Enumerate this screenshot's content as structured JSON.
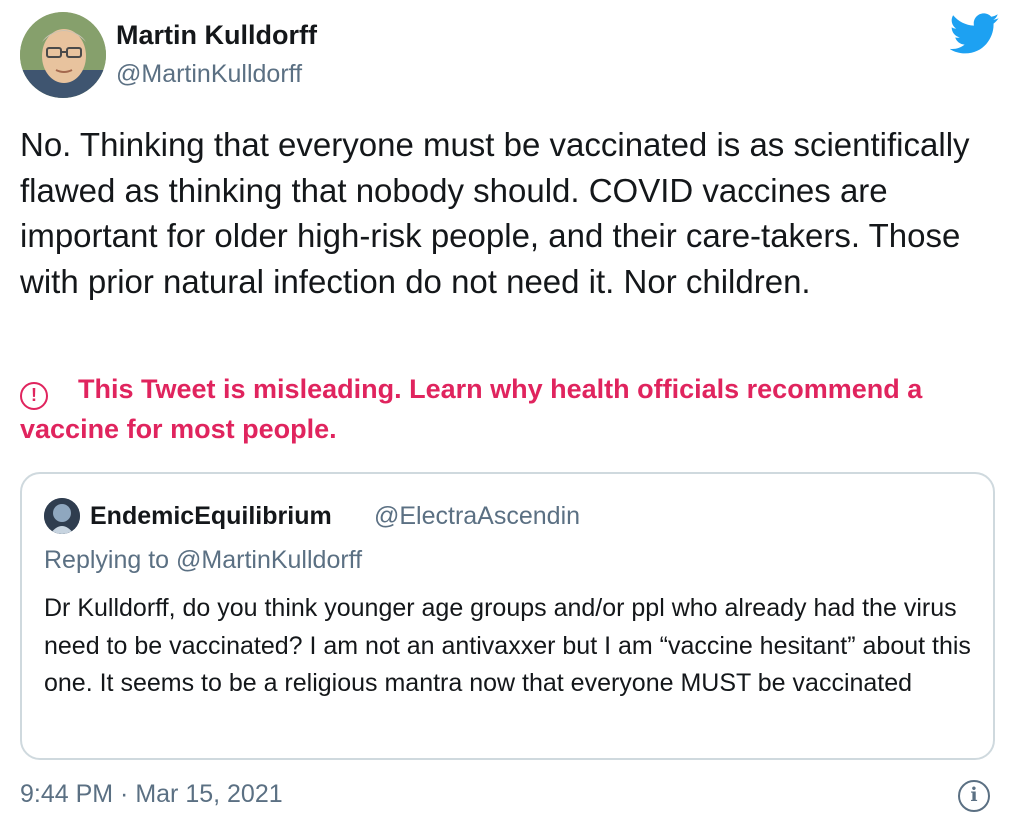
{
  "colors": {
    "twitter_blue": "#1da1f2",
    "warning_red": "#e0245e",
    "secondary_text": "#5b7083",
    "primary_text": "#14171a",
    "card_border": "#cfd9de"
  },
  "tweet": {
    "author": {
      "name": "Martin Kulldorff",
      "handle": "@MartinKulldorff",
      "avatar_icon": "profile-photo"
    },
    "logo_icon": "twitter-bird-icon",
    "text": "No. Thinking that everyone must be vaccinated is as scientifically flawed as thinking that nobody should. COVID vaccines are important for older high-risk people, and their care-takers. Those with prior natural infection do not need it. Nor children.",
    "notice": {
      "icon": "exclamation-circle-icon",
      "warn_glyph": "!",
      "text": "This Tweet is misleading. Learn why health officials recommend a vaccine for most people."
    },
    "quoted_tweet": {
      "name": "EndemicEquilibrium",
      "handle": "@ElectraAscendin",
      "replying_to": "Replying to @MartinKulldorff",
      "text": "Dr Kulldorff, do you think younger age groups and/or ppl who already had the virus need to be vaccinated? I am not an antivaxxer but I am “vaccine hesitant” about this one. It seems to be a religious mantra now that everyone MUST be vaccinated"
    },
    "timestamp": "9:44 PM · Mar 15, 2021",
    "info_icon": "info-icon",
    "info_glyph": "i"
  }
}
